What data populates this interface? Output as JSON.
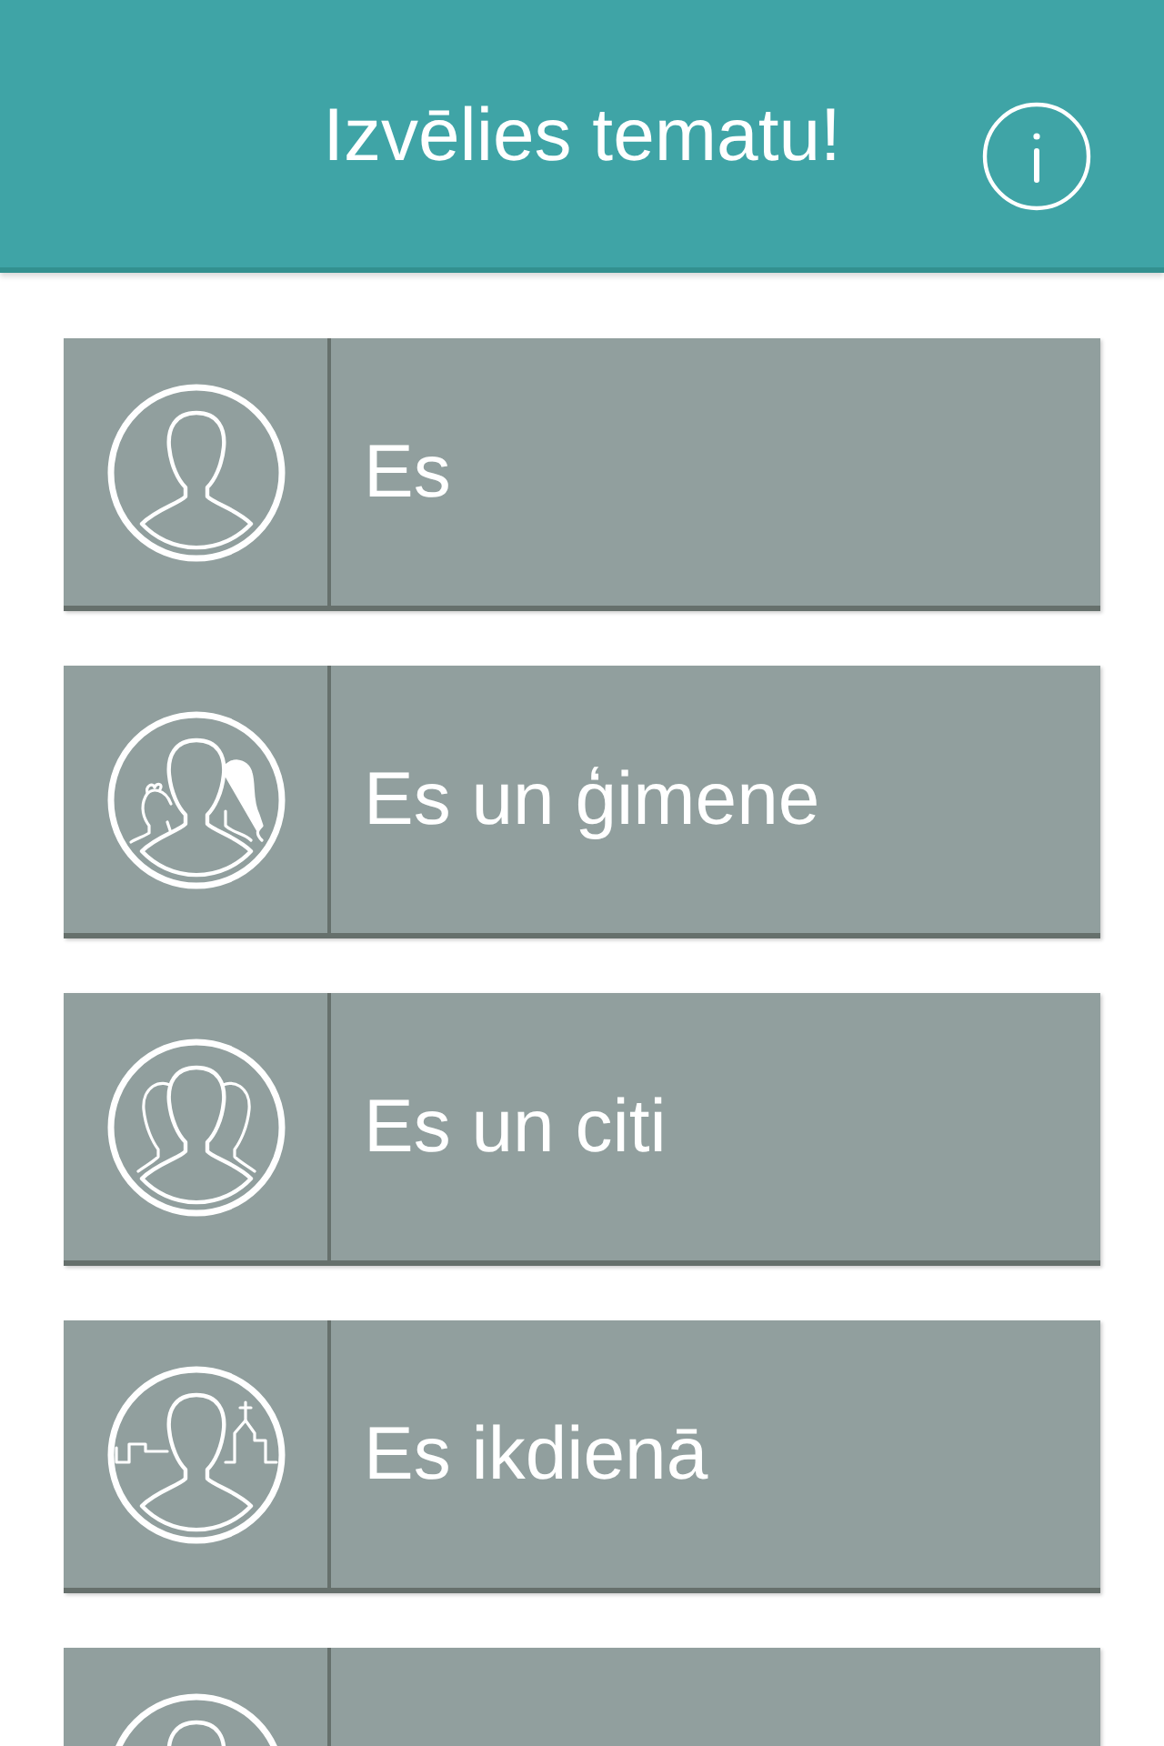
{
  "header": {
    "title": "Izvēlies tematu!"
  },
  "topics": [
    {
      "kind": "person",
      "label": "Es"
    },
    {
      "kind": "family",
      "label": "Es un ģimene"
    },
    {
      "kind": "group",
      "label": "Es un citi"
    },
    {
      "kind": "town",
      "label": "Es ikdienā"
    },
    {
      "kind": "person"
    }
  ]
}
